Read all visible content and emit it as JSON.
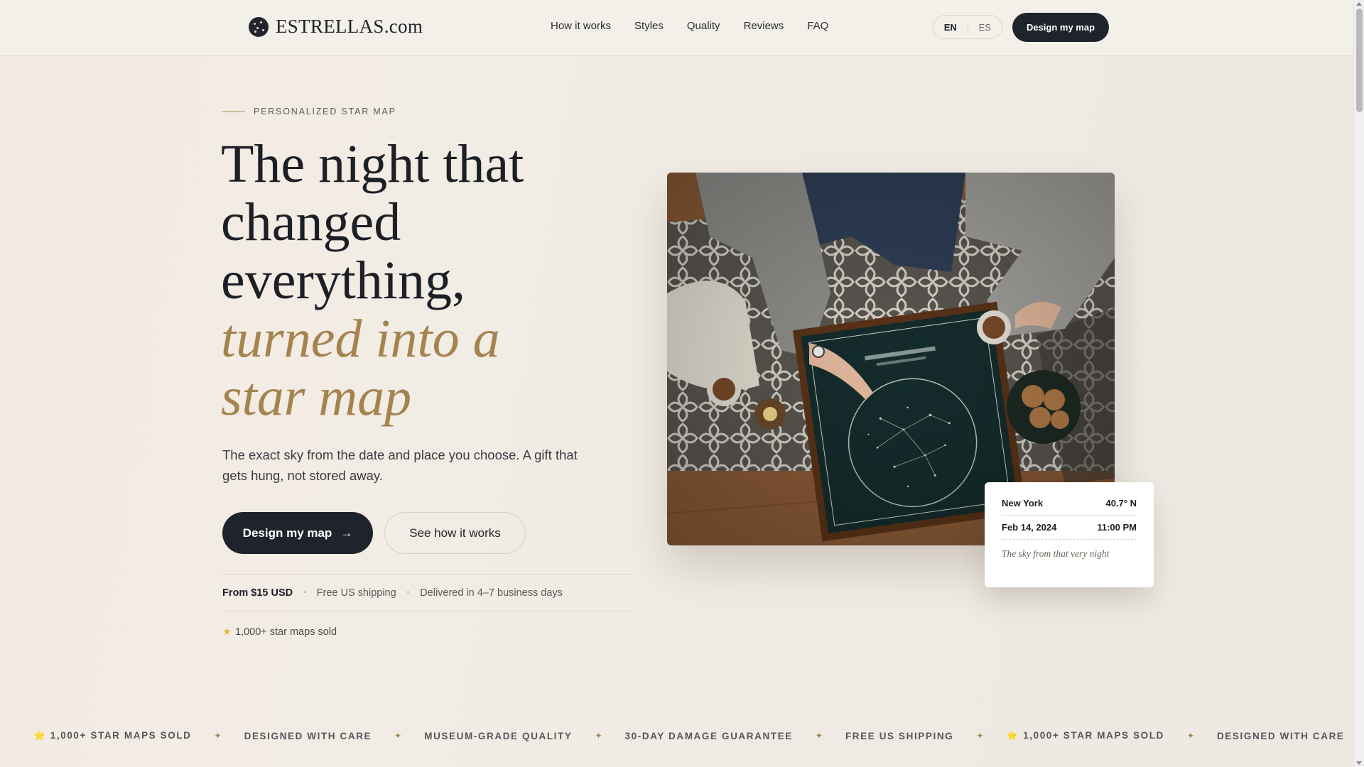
{
  "header": {
    "brand": "ESTRELLAS.com",
    "nav": [
      "How it works",
      "Styles",
      "Quality",
      "Reviews",
      "FAQ"
    ],
    "lang": {
      "en": "EN",
      "es": "ES",
      "active": "EN"
    },
    "cta": "Design my map"
  },
  "hero": {
    "eyebrow": "PERSONALIZED STAR MAP",
    "headline_line1": "The night that changed everything,",
    "headline_accent": "turned into a star map",
    "subtitle": "The exact sky from the date and place you choose. A gift that gets hung, not stored away.",
    "primary_button": "Design my map",
    "primary_arrow": "→",
    "secondary_button": "See how it works",
    "price": "From $15 USD",
    "shipping": "Free US shipping",
    "delivery": "Delivered in 4–7 business days",
    "sold": "1,000+ star maps sold"
  },
  "map_card": {
    "city": "New York",
    "latitude": "40.7° N",
    "date": "Feb 14, 2024",
    "time": "11:00 PM",
    "note": "The sky from that very night"
  },
  "ticker": [
    "⭐ 1,000+ STAR MAPS SOLD",
    "DESIGNED WITH CARE",
    "MUSEUM-GRADE QUALITY",
    "30-DAY DAMAGE GUARANTEE",
    "FREE US SHIPPING",
    "⭐ 1,000+ STAR MAPS SOLD",
    "DESIGNED WITH CARE"
  ],
  "ticker_separator": "✦",
  "colors": {
    "accent": "#a5834f",
    "dark": "#1f232b",
    "background": "#f1ece4"
  }
}
